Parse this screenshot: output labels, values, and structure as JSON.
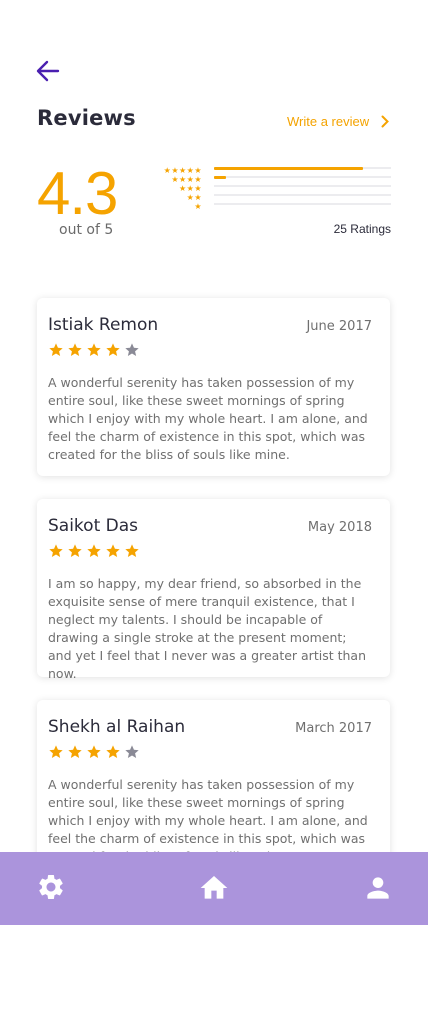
{
  "header": {
    "back_icon": "arrow-left-icon",
    "title": "Reviews",
    "write_review_label": "Write a review"
  },
  "summary": {
    "score": "4.3",
    "out_of": "out of 5",
    "ratings_count": "25 Ratings",
    "distribution": [
      {
        "stars": 5,
        "star_text": "★★★★★",
        "fraction": 0.84
      },
      {
        "stars": 4,
        "star_text": "★★★★",
        "fraction": 0.07
      },
      {
        "stars": 3,
        "star_text": "★★★",
        "fraction": 0.0
      },
      {
        "stars": 2,
        "star_text": "★★",
        "fraction": 0.0
      },
      {
        "stars": 1,
        "star_text": "★",
        "fraction": 0.0
      }
    ]
  },
  "reviews": [
    {
      "name": "Istiak Remon",
      "date": "June 2017",
      "rating": 4,
      "text": "A wonderful serenity has taken possession of my entire soul, like these sweet mornings of spring which I enjoy with my whole heart. I am alone, and feel the charm of existence in this spot, which was created for the bliss of souls like mine."
    },
    {
      "name": "Saikot Das",
      "date": "May 2018",
      "rating": 5,
      "text": "I am so happy, my dear friend, so absorbed in the exquisite sense of mere tranquil existence, that I neglect my talents. I should be incapable of drawing a single stroke at the present moment; and yet I feel that I never was a greater artist than now."
    },
    {
      "name": "Shekh al Raihan",
      "date": "March 2017",
      "rating": 4,
      "text": "A wonderful serenity has taken possession of my entire soul, like these sweet mornings of spring which I enjoy with my whole heart. I am alone, and feel the charm of existence in this spot, which was created for the bliss of souls like mine."
    }
  ],
  "navbar": {
    "items": [
      "gear-icon",
      "home-icon",
      "user-icon"
    ],
    "background": "#ab94dc"
  },
  "colors": {
    "accent": "#f5a300",
    "primary": "#4a1fb0",
    "star_empty": "#8a8a96"
  }
}
